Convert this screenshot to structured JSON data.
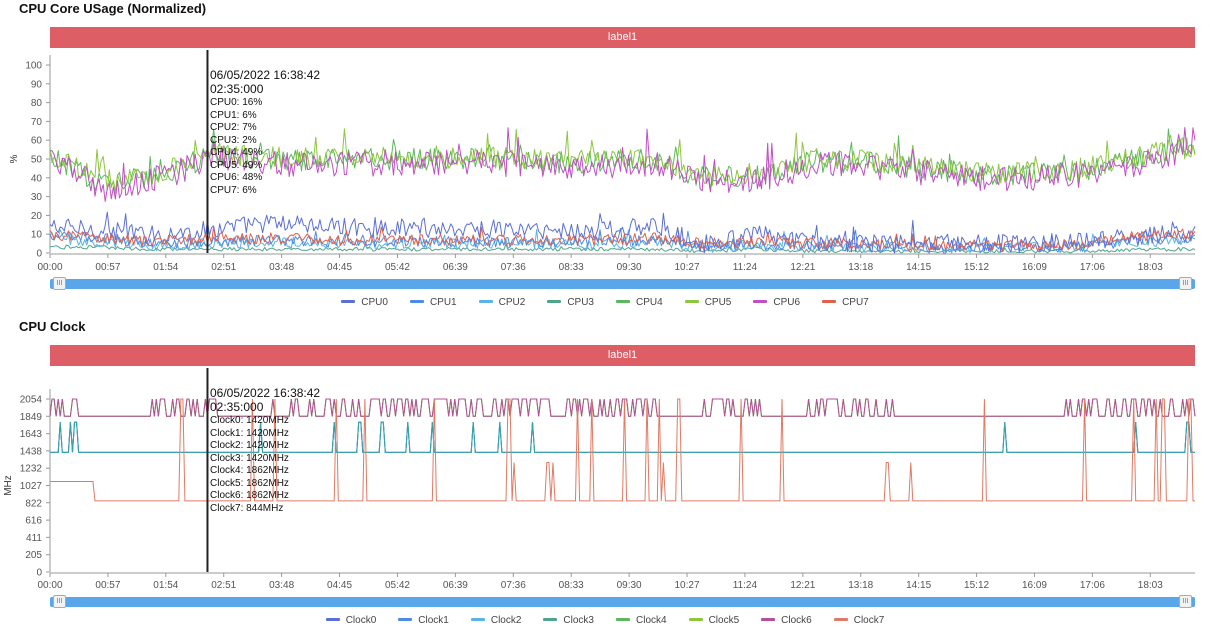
{
  "chart_data": [
    {
      "id": "cpu_usage",
      "type": "line",
      "title": "CPU Core USage (Normalized)",
      "band_label": "label1",
      "ylabel": "%",
      "xlabel": "",
      "ylim": [
        0,
        100
      ],
      "yticks": [
        "0",
        "10",
        "20",
        "30",
        "40",
        "50",
        "60",
        "70",
        "80",
        "90",
        "100"
      ],
      "ytick_values": [
        0,
        10,
        20,
        30,
        40,
        50,
        60,
        70,
        80,
        90,
        100
      ],
      "xticks": [
        "00:00",
        "00:57",
        "01:54",
        "02:51",
        "03:48",
        "04:45",
        "05:42",
        "06:39",
        "07:36",
        "08:33",
        "09:30",
        "10:27",
        "11:24",
        "12:21",
        "13:18",
        "14:15",
        "15:12",
        "16:09",
        "17:06",
        "18:03"
      ],
      "x_range_minutes": [
        0,
        1127
      ],
      "grid": false,
      "legend_position": "bottom",
      "series": [
        {
          "name": "CPU0",
          "color": "#5b6fd6",
          "profile": [
            14,
            12,
            9,
            13,
            16,
            14,
            14,
            13,
            13,
            12,
            12,
            14,
            5,
            10,
            5,
            5,
            5,
            5,
            5,
            6,
            9,
            10
          ],
          "noise": 5
        },
        {
          "name": "CPU1",
          "color": "#4e8be8",
          "profile": [
            9,
            8,
            5,
            6,
            7,
            6,
            6,
            6,
            6,
            6,
            6,
            7,
            4,
            5,
            4,
            4,
            3,
            3,
            3,
            3,
            7,
            8
          ],
          "noise": 3
        },
        {
          "name": "CPU2",
          "color": "#5ab4e8",
          "profile": [
            8,
            6,
            4,
            5,
            6,
            5,
            5,
            5,
            5,
            5,
            5,
            6,
            3,
            4,
            3,
            3,
            3,
            3,
            3,
            3,
            6,
            7
          ],
          "noise": 3
        },
        {
          "name": "CPU3",
          "color": "#4fa58c",
          "profile": [
            3,
            3,
            2,
            2,
            2,
            2,
            2,
            2,
            2,
            2,
            2,
            2,
            1,
            2,
            1,
            1,
            1,
            1,
            1,
            1,
            2,
            2
          ],
          "noise": 1
        },
        {
          "name": "CPU4",
          "color": "#5cb85c",
          "profile": [
            52,
            36,
            42,
            52,
            50,
            49,
            50,
            50,
            50,
            48,
            48,
            50,
            40,
            41,
            49,
            48,
            45,
            42,
            42,
            44,
            50,
            56
          ],
          "noise": 6
        },
        {
          "name": "CPU5",
          "color": "#8dc63f",
          "profile": [
            53,
            37,
            43,
            53,
            51,
            50,
            51,
            51,
            51,
            49,
            49,
            51,
            41,
            42,
            50,
            49,
            46,
            43,
            43,
            45,
            51,
            57
          ],
          "noise": 6
        },
        {
          "name": "CPU6",
          "color": "#c04fc4",
          "profile": [
            50,
            34,
            40,
            50,
            48,
            47,
            48,
            48,
            48,
            46,
            46,
            48,
            38,
            39,
            47,
            46,
            43,
            40,
            40,
            42,
            48,
            54
          ],
          "noise": 7
        },
        {
          "name": "CPU7",
          "color": "#e0604a",
          "profile": [
            10,
            8,
            6,
            8,
            8,
            7,
            7,
            7,
            7,
            7,
            7,
            8,
            5,
            6,
            5,
            5,
            4,
            4,
            4,
            5,
            9,
            10
          ],
          "noise": 3
        }
      ],
      "cursor": {
        "minute": 155,
        "date": "06/05/2022 16:38:42",
        "time": "02:35:000",
        "values": [
          "CPU0: 16%",
          "CPU1: 6%",
          "CPU2: 7%",
          "CPU3: 2%",
          "CPU4: 49%",
          "CPU5: 49%",
          "CPU6: 48%",
          "CPU7: 6%"
        ]
      }
    },
    {
      "id": "cpu_clock",
      "type": "line",
      "title": "CPU Clock",
      "band_label": "label1",
      "ylabel": "MHz",
      "xlabel": "",
      "ylim": [
        0,
        2054
      ],
      "yticks": [
        "0",
        "205",
        "411",
        "616",
        "822",
        "1027",
        "1232",
        "1438",
        "1643",
        "1849",
        "2054"
      ],
      "ytick_values": [
        0,
        205,
        411,
        616,
        822,
        1027,
        1232,
        1438,
        1643,
        1849,
        2054
      ],
      "xticks": [
        "00:00",
        "00:57",
        "01:54",
        "02:51",
        "03:48",
        "04:45",
        "05:42",
        "06:39",
        "07:36",
        "08:33",
        "09:30",
        "10:27",
        "11:24",
        "12:21",
        "13:18",
        "14:15",
        "15:12",
        "16:09",
        "17:06",
        "18:03"
      ],
      "x_range_minutes": [
        0,
        1127
      ],
      "grid": false,
      "legend_position": "bottom",
      "series": [
        {
          "name": "Clock0",
          "color": "#5b6fd6",
          "base": 1420,
          "spikes": [
            10,
            20,
            25,
            208,
            280,
            305,
            327,
            352,
            377,
            416,
            442,
            475,
            940,
            1068,
            1120
          ],
          "spike_to": 1780
        },
        {
          "name": "Clock1",
          "color": "#4e8be8",
          "base": 1420,
          "spikes": [
            10,
            20,
            25,
            208,
            280,
            305,
            327,
            352,
            377,
            416,
            442,
            475,
            940,
            1068,
            1120
          ],
          "spike_to": 1780
        },
        {
          "name": "Clock2",
          "color": "#5ab4e8",
          "base": 1420,
          "spikes": [
            10,
            20,
            25,
            208,
            280,
            305,
            327,
            352,
            377,
            416,
            442,
            475,
            940,
            1068,
            1120
          ],
          "spike_to": 1780
        },
        {
          "name": "Clock3",
          "color": "#4fa58c",
          "base": 1420,
          "spikes": [
            10,
            20,
            25,
            208,
            280,
            305,
            327,
            352,
            377,
            416,
            442,
            475,
            940,
            1068,
            1120
          ],
          "spike_to": 1780
        },
        {
          "name": "Clock4",
          "color": "#5cb85c",
          "base": 1849,
          "high": 2054,
          "switch_density": 0.35
        },
        {
          "name": "Clock5",
          "color": "#8dc63f",
          "base": 1849,
          "high": 2054,
          "switch_density": 0.35
        },
        {
          "name": "Clock6",
          "color": "#b5509a",
          "base": 1849,
          "high": 2054,
          "switch_density": 0.35
        },
        {
          "name": "Clock7",
          "color": "#e07a64",
          "base": 844,
          "initial": 1075,
          "initial_until": 43,
          "spikes_full": [
            128,
            131,
            200,
            221,
            282,
            310,
            378,
            452,
            519,
            534,
            566,
            588,
            599,
            619,
            680,
            721,
            920,
            1018,
            1067,
            1089,
            1096,
            1122
          ],
          "spikes_mid": [
            457,
            490,
            495,
            824,
            848,
            603
          ],
          "spike_full_to": 2054,
          "spike_mid_to": 1300
        }
      ],
      "cursor": {
        "minute": 155,
        "date": "06/05/2022 16:38:42",
        "time": "02:35:000",
        "values": [
          "Clock0: 1420MHz",
          "Clock1: 1420MHz",
          "Clock2: 1420MHz",
          "Clock3: 1420MHz",
          "Clock4: 1862MHz",
          "Clock5: 1862MHz",
          "Clock6: 1862MHz",
          "Clock7: 844MHz"
        ]
      }
    }
  ],
  "sections": [
    {
      "title": "CPU Core USage (Normalized)",
      "band_label": "label1"
    },
    {
      "title": "CPU Clock",
      "band_label": "label1"
    }
  ],
  "slider": {
    "handle_glyph": "III"
  }
}
